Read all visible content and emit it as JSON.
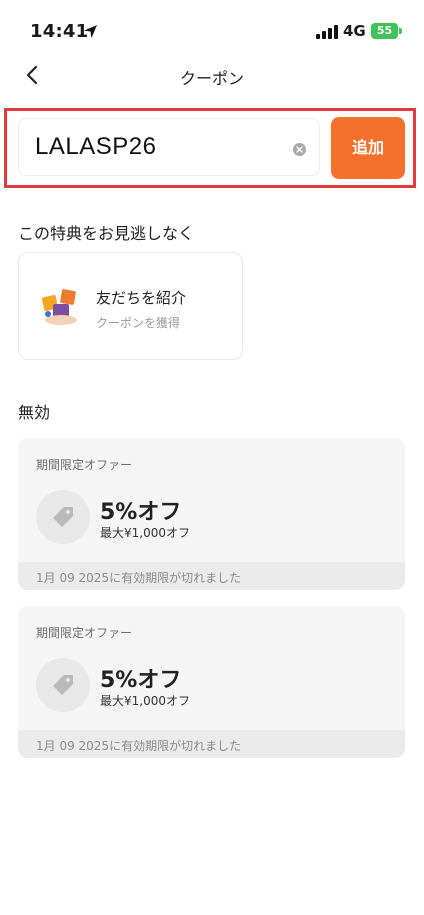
{
  "status_bar": {
    "time": "14:41",
    "network": "4G",
    "battery": "55"
  },
  "nav": {
    "title": "クーポン"
  },
  "coupon_input": {
    "value": "LALASP26",
    "add_label": "追加"
  },
  "promo_section": {
    "title": "この特典をお見逃しなく",
    "referral": {
      "title": "友だちを紹介",
      "subtitle": "クーポンを獲得"
    }
  },
  "invalid_section": {
    "title": "無効",
    "coupons": [
      {
        "label": "期間限定オファー",
        "discount": "5%オフ",
        "max": "最大¥1,000オフ",
        "expiry": "1月 09 2025に有効期限が切れました"
      },
      {
        "label": "期間限定オファー",
        "discount": "5%オフ",
        "max": "最大¥1,000オフ",
        "expiry": "1月 09 2025に有効期限が切れました"
      }
    ]
  },
  "colors": {
    "accent": "#f5702a",
    "highlight_border": "#e03a3a",
    "battery": "#3fc25a"
  },
  "icons": [
    "location-arrow-icon",
    "signal-icon",
    "battery-icon",
    "back-chevron-icon",
    "clear-icon",
    "referral-gift-icon",
    "tag-icon"
  ]
}
